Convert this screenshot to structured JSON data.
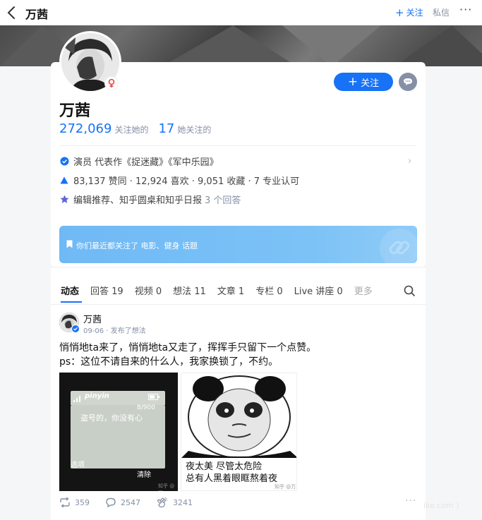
{
  "topbar": {
    "title": "万茜",
    "follow_label": "关注",
    "message_label": "私信",
    "more_label": "···"
  },
  "profile": {
    "name": "万茜",
    "follow_button": "关注",
    "followers_count": "272,069",
    "followers_label": "关注她的",
    "following_count": "17",
    "following_label": "她关注的",
    "identity": "演员 代表作《捉迷藏》《军中乐园》",
    "achievements": "83,137 赞同 · 12,924 喜欢 · 9,051 收藏 · 7 专业认可",
    "recommend": "编辑推荐、知乎圆桌和知乎日报",
    "recommend_link": "3 个回答",
    "interest_banner": "你们最近都关注了 电影、健身 话题"
  },
  "tabs": [
    {
      "label": "动态"
    },
    {
      "label": "回答 19"
    },
    {
      "label": "视频 0"
    },
    {
      "label": "想法 11"
    },
    {
      "label": "文章 1"
    },
    {
      "label": "专栏 0"
    },
    {
      "label": "Live 讲座 0"
    },
    {
      "label": "更多"
    }
  ],
  "post": {
    "author": "万茜",
    "meta": "09-06 · 发布了想法",
    "line1": "悄悄地ta来了，悄悄地ta又走了，挥挥手只留下一个点赞。",
    "line2": "ps：这位不请自来的什么人，我家换锁了，不约。",
    "image1": {
      "brand": "pinyin",
      "counter": "8/900",
      "text": "盗号的，你没有心",
      "left_soft": "选项",
      "right_soft": "清除",
      "watermark": "知乎 @万"
    },
    "image2": {
      "caption_line1": "夜太美 尽管太危险",
      "caption_line2": "总有人黑着眼眶熬着夜",
      "watermark": "知乎 @万茜"
    },
    "reposts": "359",
    "comments": "2547",
    "likes": "3241",
    "more": "···"
  },
  "watermark": "ike.com )",
  "colors": {
    "accent": "#1772f6",
    "muted": "#8590a6",
    "banner": "#7cc2f6"
  }
}
